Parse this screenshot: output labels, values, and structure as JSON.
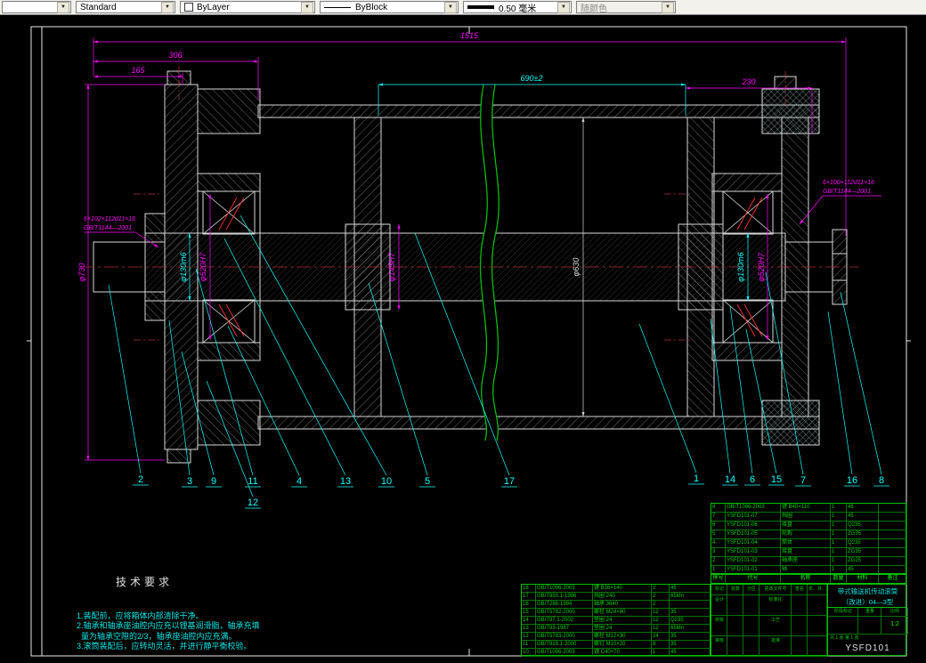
{
  "toolbar": {
    "combo1": "",
    "style": "Standard",
    "color": "ByLayer",
    "linetype": "ByBlock",
    "lineweight": "0.50 毫米",
    "plotstyle": "随颜色"
  },
  "colors": {
    "background": "#000000",
    "geometry": "#d8d8d8",
    "dimension": "#ff00ff",
    "leader": "#00ffff",
    "table": "#00d000",
    "break_line": "#00bb00",
    "centerline": "#b03030"
  },
  "dims": {
    "overall": "1515",
    "left_section": "306",
    "left_end": "165",
    "mid_section": "690±2",
    "right_section": "230",
    "flange_dia": "φ730",
    "bore_left": "φ520H7",
    "shaft_left": "φ130m6",
    "hub_bore": "φ145H7",
    "drum_inner": "φ630",
    "shaft_right": "φ130m6",
    "bore_right": "φ520H7"
  },
  "callouts": {
    "left_line1": "6×102×112d11×16",
    "left_line2": "GB/T1144—2001",
    "right_line1": "6×100×112d11×16",
    "right_line2": "GB/T1144—2001"
  },
  "balloons": [
    "2",
    "3",
    "9",
    "11",
    "12",
    "4",
    "13",
    "10",
    "5",
    "17",
    "1",
    "14",
    "6",
    "15",
    "7",
    "16",
    "8"
  ],
  "tech_req": {
    "title": "技术要求",
    "lines": [
      "1.装配前，应将箱体内部清除干净。",
      "2.轴承和轴承座油腔内应充以锂基润滑脂，轴承充填",
      "  量为轴承空隙的2/3，轴承座油腔内应充满。",
      "3.滚筒装配后，应转动灵活，并进行静平衡校验。"
    ]
  },
  "bom_upper": {
    "rows": [
      [
        "8",
        "GB/T1096-2003",
        "键 B40×110",
        "1",
        "45",
        ""
      ],
      [
        "7",
        "YSFD101-07",
        "挡圈",
        "1",
        "45",
        ""
      ],
      [
        "6",
        "YSFD101-06",
        "接盘",
        "1",
        "Q235",
        ""
      ],
      [
        "5",
        "YSFD101-05",
        "轮毂",
        "1",
        "ZG35",
        ""
      ],
      [
        "4",
        "YSFD101-04",
        "筒体",
        "1",
        "Q235",
        ""
      ],
      [
        "3",
        "YSFD101-03",
        "接盘",
        "1",
        "ZG35",
        ""
      ],
      [
        "2",
        "YSFD101-02",
        "轴承座",
        "1",
        "ZG25",
        ""
      ],
      [
        "1",
        "YSFD101-01",
        "轴",
        "1",
        "45",
        ""
      ]
    ],
    "header_rows": [
      [
        "序号",
        "代号",
        "名称",
        "数量",
        "材料",
        "备注"
      ]
    ]
  },
  "bom_left": {
    "rows": [
      [
        "18",
        "GB/T1096-2003",
        "键 B36×140",
        "2",
        "45"
      ],
      [
        "17",
        "GB/T893.1-1986",
        "挡圈 240",
        "2",
        "65Mn"
      ],
      [
        "16",
        "GB/T288-1994",
        "轴承 3640",
        "2",
        ""
      ],
      [
        "15",
        "GB/T5782-2000",
        "螺栓 M24×80",
        "12",
        "35"
      ],
      [
        "14",
        "GB/T97.1-2002",
        "垫圈 24",
        "12",
        "Q235"
      ],
      [
        "13",
        "GB/T93-1987",
        "垫圈 24",
        "12",
        "65Mn"
      ],
      [
        "12",
        "GB/T5783-2000",
        "螺栓 M12×30",
        "24",
        "35"
      ],
      [
        "11",
        "GB/T819.1-2000",
        "螺钉 M10×20",
        "8",
        "35"
      ],
      [
        "10",
        "GB/T1096-2003",
        "键 C40×70",
        "1",
        "45"
      ]
    ]
  },
  "title_block": {
    "rev_rows": [
      [
        "标记",
        "处数",
        "分区",
        "更改文件号",
        "签名",
        "年、月、日"
      ]
    ],
    "sig_rows": [
      [
        "设计",
        "",
        "",
        "标准化",
        "",
        ""
      ],
      [
        "校核",
        "",
        "",
        "工艺",
        "",
        ""
      ],
      [
        "审核",
        "",
        "",
        "批准",
        "",
        ""
      ]
    ],
    "name_line1": "带式输送机传动滚筒",
    "name_line2": "（改进）04—3型",
    "stage_label": "阶段标记",
    "weight_label": "重量",
    "scale_label": "比例",
    "scale_value": "1:2",
    "sheet_info": "共 1 张  第 1 张",
    "drawing_no": "YSFD101"
  }
}
